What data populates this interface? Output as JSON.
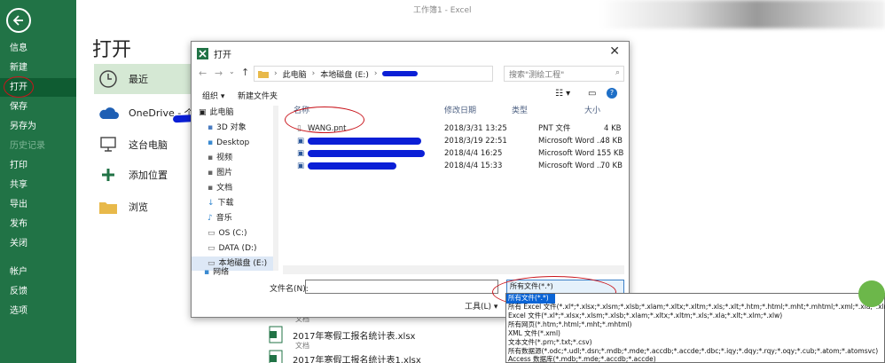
{
  "app": {
    "window_title": "工作簿1  -  Excel"
  },
  "sidebar": {
    "items": [
      "信息",
      "新建",
      "打开",
      "保存",
      "另存为",
      "历史记录",
      "打印",
      "共享",
      "导出",
      "发布",
      "关闭",
      "帐户",
      "反馈",
      "选项"
    ]
  },
  "main": {
    "title": "打开",
    "places": [
      {
        "label": "最近"
      },
      {
        "label": "OneDrive - 个人"
      },
      {
        "label": "这台电脑"
      },
      {
        "label": "添加位置"
      },
      {
        "label": "浏览"
      }
    ],
    "recent": [
      {
        "name": "",
        "sub": "文档"
      },
      {
        "name": "2017年寒假工报名统计表.xlsx",
        "sub": "文档"
      },
      {
        "name": "2017年寒假工报名统计表1.xlsx",
        "sub": ""
      }
    ]
  },
  "dialog": {
    "title": "打开",
    "breadcrumb": [
      "此电脑",
      "本地磁盘 (E:)"
    ],
    "search_placeholder": "搜索\"测绘工程\"",
    "toolbar": {
      "organize": "组织 ▾",
      "new_folder": "新建文件夹"
    },
    "tree": [
      "此电脑",
      "3D 对象",
      "Desktop",
      "视频",
      "图片",
      "文档",
      "下载",
      "音乐",
      "OS (C:)",
      "DATA (D:)",
      "本地磁盘 (E:)",
      "网络"
    ],
    "columns": {
      "name": "名称",
      "modified": "修改日期",
      "type": "类型",
      "size": "大小"
    },
    "files": [
      {
        "name": "WANG.pnt",
        "modified": "2018/3/31 13:25",
        "type": "PNT 文件",
        "size": "4 KB"
      },
      {
        "name": "",
        "modified": "2018/3/19 22:51",
        "type": "Microsoft Word ...",
        "size": "48 KB"
      },
      {
        "name": "",
        "modified": "2018/4/4 16:25",
        "type": "Microsoft Word ...",
        "size": "155 KB"
      },
      {
        "name": "",
        "modified": "2018/4/4 15:33",
        "type": "Microsoft Word ...",
        "size": "70 KB"
      }
    ],
    "filename_label": "文件名(N):",
    "filetype_value": "所有文件(*.*)",
    "tools_label": "工具(L)  ▾"
  },
  "filetype_options": [
    "所有文件(*.*)",
    "所有 Excel 文件(*.xl*;*.xlsx;*.xlsm;*.xlsb;*.xlam;*.xltx;*.xltm;*.xls;*.xlt;*.htm;*.html;*.mht;*.mhtml;*.xml;*.xla;*.xlm;*.x",
    "Excel 文件(*.xl*;*.xlsx;*.xlsm;*.xlsb;*.xlam;*.xltx;*.xltm;*.xls;*.xla;*.xlt;*.xlm;*.xlw)",
    "所有网页(*.htm;*.html;*.mht;*.mhtml)",
    "XML 文件(*.xml)",
    "文本文件(*.prn;*.txt;*.csv)",
    "所有数据源(*.odc;*.udl;*.dsn;*.mdb;*.mde;*.accdb;*.accde;*.dbc;*.iqy;*.dqy;*.rqy;*.oqy;*.cub;*.atom;*.atomsvc)",
    "Access 数据库(*.mdb;*.mde;*.accdb;*.accde)"
  ],
  "colors": {
    "excel_green": "#217346",
    "active_green": "#0f5c32",
    "selection_blue": "#0a64d6",
    "annotation_red": "#c9141b",
    "scribble_blue": "#0b1fd6"
  }
}
